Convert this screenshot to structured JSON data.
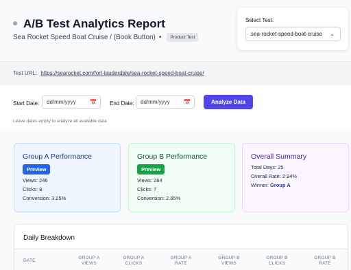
{
  "header": {
    "title": "A/B Test Analytics Report",
    "subtitle": "Sea Rocket Speed Boat Cruise / (Book Button)",
    "separator": "•",
    "badge": "Product Test"
  },
  "test_select": {
    "label": "Select Test:",
    "value": "sea-rocket-speed-boat-cruise"
  },
  "test_url": {
    "label": "Test URL:",
    "link": "https://searocket.com/fort-lauderdale/sea-rocket-speed-boat-cruise/"
  },
  "date_filter": {
    "start_label": "Start Date:",
    "start_placeholder": "dd/mm/yyyy",
    "end_label": "End Date:",
    "end_placeholder": "dd/mm/yyyy",
    "button": "Analyze Data",
    "hint": "Leave dates empty to analyze all available data"
  },
  "group_a": {
    "title": "Group A Performance",
    "tag": "Preview",
    "views": "Views: 246",
    "clicks": "Clicks: 8",
    "conversion": "Conversion: 3.25%"
  },
  "group_b": {
    "title": "Group B Performance",
    "tag": "Preview",
    "views": "Views: 264",
    "clicks": "Clicks: 7",
    "conversion": "Conversion: 2.65%"
  },
  "summary": {
    "title": "Overall Summary",
    "total_days": "Total Days: 25",
    "overall_rate": "Overall Rate: 2.94%",
    "winner_label": "Winner:",
    "winner_value": "Group A"
  },
  "breakdown": {
    "title": "Daily Breakdown",
    "columns": [
      {
        "l1": "Date",
        "l2": ""
      },
      {
        "l1": "Group A",
        "l2": "Views"
      },
      {
        "l1": "Group A",
        "l2": "Clicks"
      },
      {
        "l1": "Group A",
        "l2": "Rate"
      },
      {
        "l1": "Group B",
        "l2": "Views"
      },
      {
        "l1": "Group B",
        "l2": "Clicks"
      },
      {
        "l1": "Group B",
        "l2": "Rate"
      }
    ]
  },
  "icons": {
    "select_chevron": "chevron-down-icon",
    "date_picker": "calendar-icon"
  },
  "colors": {
    "accent": "#4f46e5",
    "group_a": "#2563eb",
    "group_b": "#16a34a"
  }
}
